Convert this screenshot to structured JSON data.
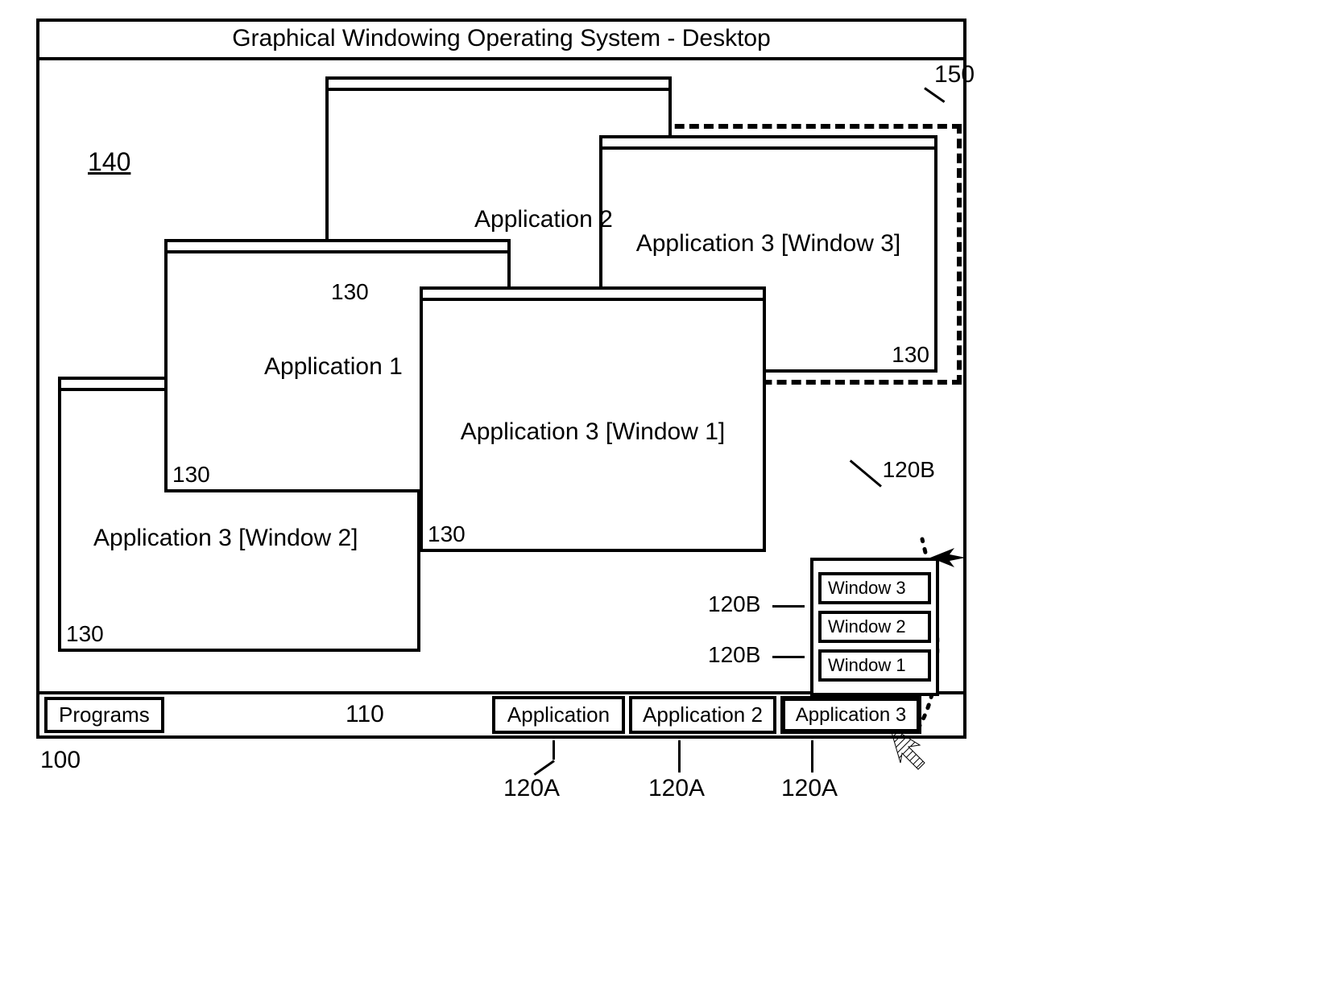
{
  "title": "Graphical Windowing Operating System - Desktop",
  "taskbar": {
    "programs": "Programs",
    "label110": "110",
    "items": [
      "Application",
      "Application 2",
      "Application 3"
    ]
  },
  "windows": {
    "app1": "Application 1",
    "app2": "Application 2",
    "app3w1": "Application 3 [Window 1]",
    "app3w2": "Application 3 [Window 2]",
    "app3w3": "Application 3 [Window 3]"
  },
  "popup": {
    "items": [
      "Window 3",
      "Window 2",
      "Window 1"
    ]
  },
  "refs": {
    "r100": "100",
    "r110": "110",
    "r120a": "120A",
    "r120b": "120B",
    "r130": "130",
    "r140": "140",
    "r150": "150"
  }
}
